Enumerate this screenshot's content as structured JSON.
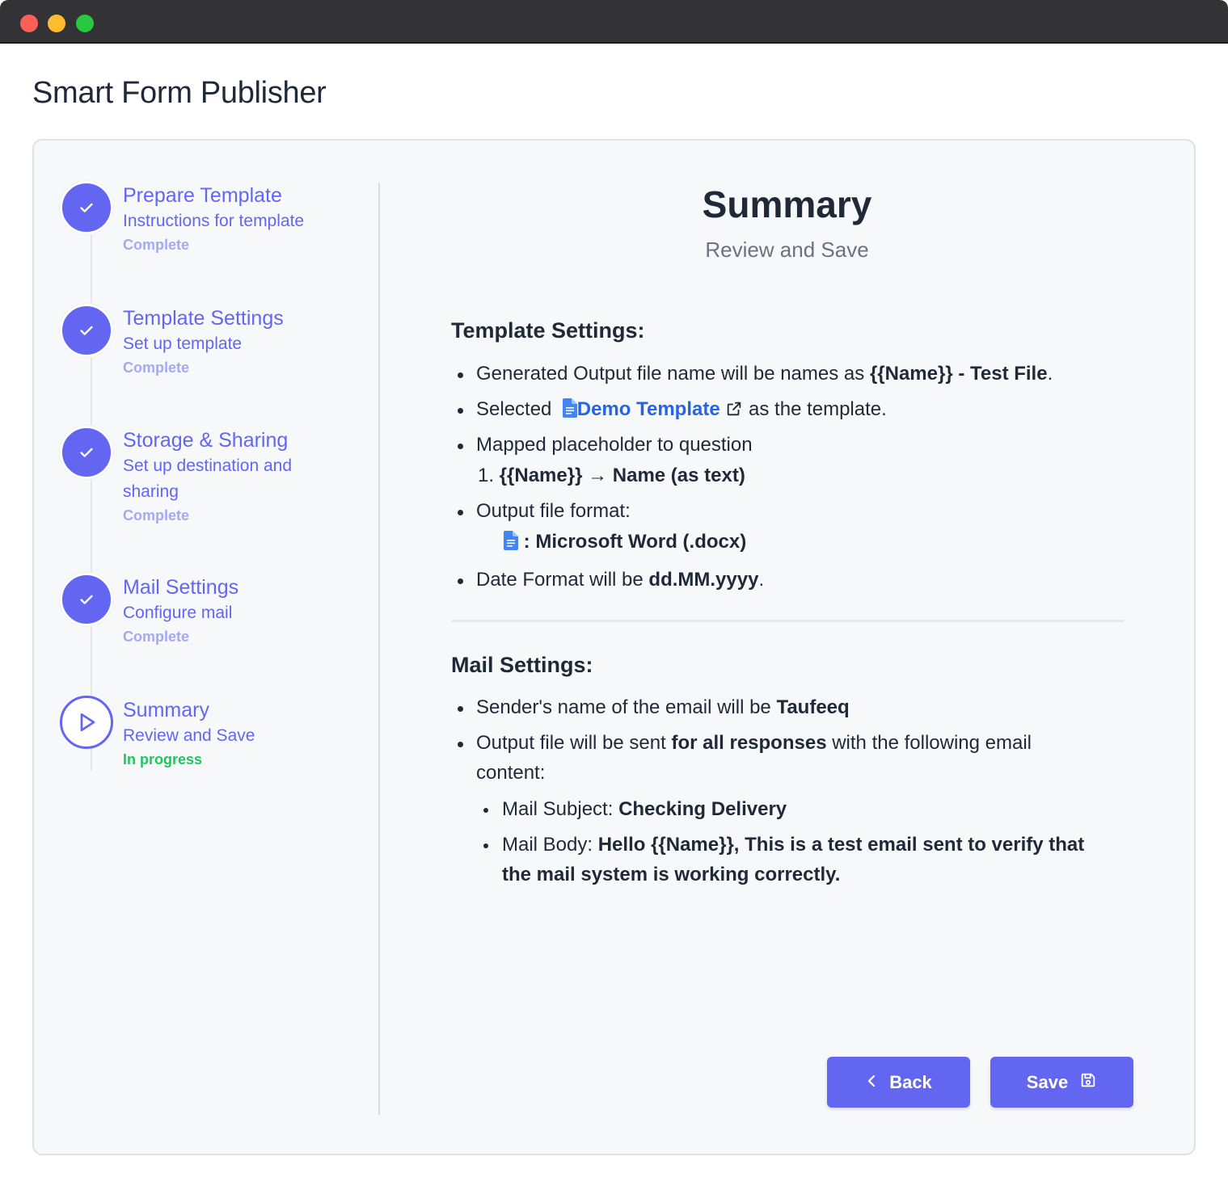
{
  "app": {
    "title": "Smart Form Publisher"
  },
  "steps": [
    {
      "title": "Prepare Template",
      "subtitle": "Instructions for template",
      "status": "Complete"
    },
    {
      "title": "Template Settings",
      "subtitle": "Set up template",
      "status": "Complete"
    },
    {
      "title": "Storage & Sharing",
      "subtitle": "Set up destination and sharing",
      "status": "Complete"
    },
    {
      "title": "Mail Settings",
      "subtitle": "Configure mail",
      "status": "Complete"
    },
    {
      "title": "Summary",
      "subtitle": "Review and Save",
      "status": "In progress"
    }
  ],
  "main": {
    "title": "Summary",
    "subtitle": "Review and Save",
    "template_settings": {
      "heading": "Template Settings:",
      "output_name_prefix": "Generated Output file name will be names as",
      "output_name_value": "{{Name}} - Test File",
      "output_name_suffix": ".",
      "selected_prefix": "Selected",
      "template_link": "Demo Template",
      "selected_suffix": "as the template.",
      "mapped_label": "Mapped placeholder to question",
      "mapping_number": "1.",
      "mapping_placeholder": "{{Name}}",
      "mapping_arrow": "→",
      "mapping_question": "Name (as text)",
      "format_label": "Output file format:",
      "format_value": ": Microsoft Word (.docx)",
      "date_prefix": "Date Format will be",
      "date_value": "dd.MM.yyyy",
      "date_suffix": "."
    },
    "mail_settings": {
      "heading": "Mail Settings:",
      "sender_prefix": "Sender's name of the email will be",
      "sender_value": "Taufeeq",
      "output_prefix": "Output file will be sent",
      "output_value": "for all responses",
      "output_suffix_line1": "with the following email",
      "output_suffix_line2": "content:",
      "subject_label": "Mail Subject:",
      "subject_value": "Checking Delivery",
      "body_label": "Mail Body:",
      "body_value_line1": "Hello {{Name}}, This is a test email sent to verify that",
      "body_value_line2": "the mail system is working correctly."
    }
  },
  "buttons": {
    "back": "Back",
    "save": "Save"
  },
  "colors": {
    "accent": "#6366f1",
    "link": "#2563eb",
    "in_progress": "#22c55e",
    "complete_status": "#a5a8f5"
  }
}
